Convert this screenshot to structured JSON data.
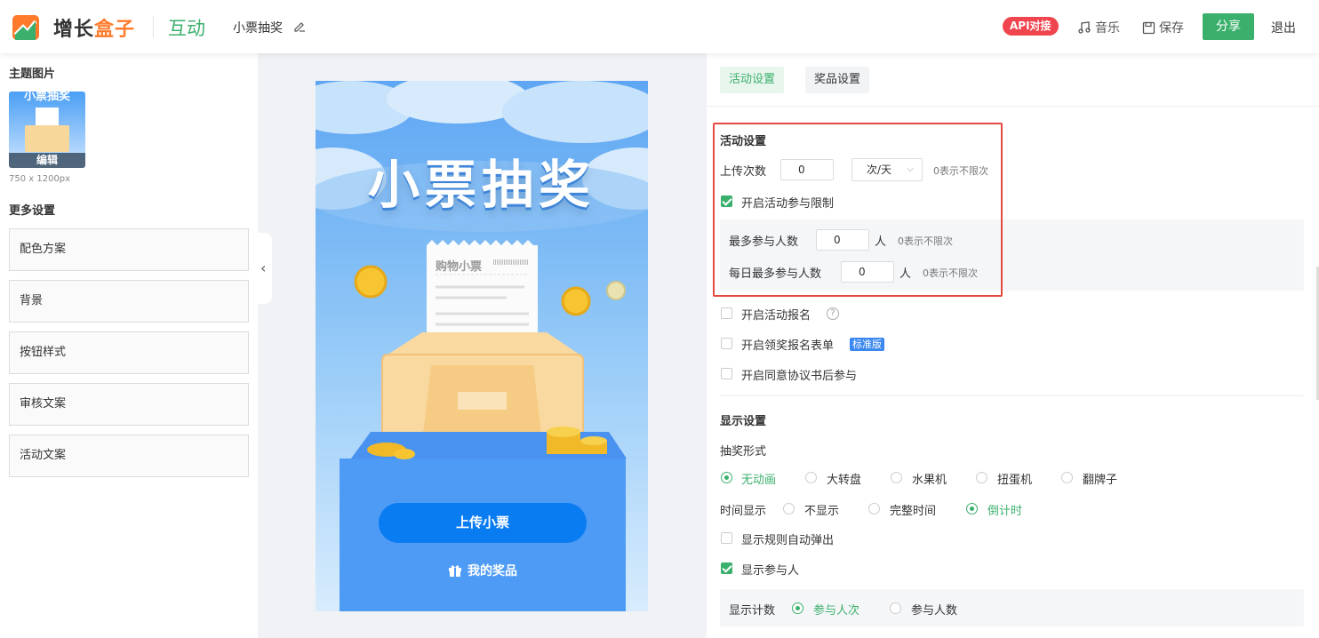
{
  "header": {
    "logo_main": "增长",
    "logo_accent": "盒子",
    "product": "互动",
    "project_title": "小票抽奖",
    "api_badge": "API对接",
    "music": "音乐",
    "save": "保存",
    "share": "分享",
    "logout": "退出"
  },
  "sidebar": {
    "theme_title": "主题图片",
    "thumb_title": "小票抽奖",
    "thumb_edit": "编辑",
    "thumb_size": "750 x 1200px",
    "more_title": "更多设置",
    "items": [
      "配色方案",
      "背景",
      "按钮样式",
      "审核文案",
      "活动文案"
    ]
  },
  "preview": {
    "title": "小票抽奖",
    "receipt_title": "购物小票",
    "upload_button": "上传小票",
    "my_prize": "我的奖品"
  },
  "tabs": [
    "活动设置",
    "奖品设置"
  ],
  "activity": {
    "title": "活动设置",
    "upload_times_label": "上传次数",
    "upload_times_value": "0",
    "upload_period": "次/天",
    "unlimited_hint": "0表示不限次",
    "limit_label": "开启活动参与限制",
    "limit_checked": true,
    "max_people_label": "最多参与人数",
    "max_people_value": "0",
    "unit_person": "人",
    "daily_max_label": "每日最多参与人数",
    "daily_max_value": "0",
    "signup_label": "开启活动报名",
    "prize_form_label": "开启领奖报名表单",
    "standard_badge": "标准版",
    "agreement_label": "开启同意协议书后参与"
  },
  "display": {
    "title": "显示设置",
    "draw_form_label": "抽奖形式",
    "draw_options": [
      "无动画",
      "大转盘",
      "水果机",
      "扭蛋机",
      "翻牌子"
    ],
    "draw_selected": "无动画",
    "time_label": "时间显示",
    "time_options": [
      "不显示",
      "完整时间",
      "倒计时"
    ],
    "time_selected": "倒计时",
    "rules_popup_label": "显示规则自动弹出",
    "show_participants_label": "显示参与人",
    "show_participants_checked": true,
    "count_label": "显示计数",
    "count_options": [
      "参与人次",
      "参与人数"
    ],
    "count_selected": "参与人次"
  },
  "colors": {
    "brand_green": "#3bb06c",
    "accent_orange": "#ff7a2b",
    "api_red": "#f0454e",
    "highlight_red": "#e34b40",
    "button_blue": "#0a7cf2"
  }
}
